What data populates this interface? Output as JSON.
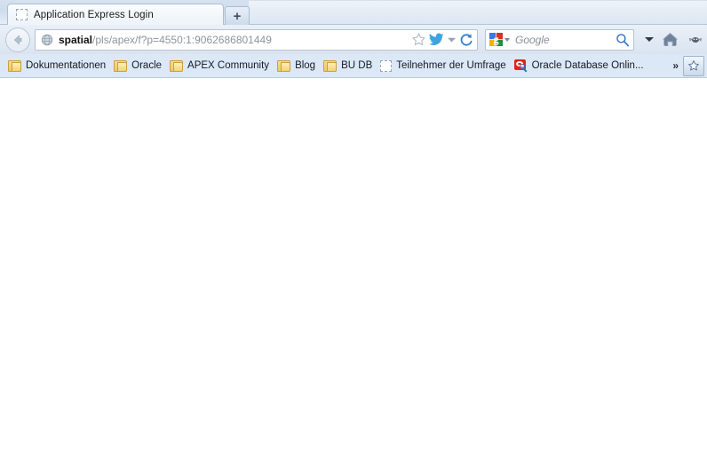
{
  "window": {
    "tab": {
      "title": "Application Express Login",
      "favicon": "placeholder-favicon"
    },
    "new_tab_label": "+"
  },
  "navigation": {
    "back_label": "←",
    "url": {
      "host": "spatial",
      "path": "/pls/apex/f?p=4550:1:9062686801449",
      "full": "spatial/pls/apex/f?p=4550:1:9062686801449"
    },
    "icons": {
      "site": "globe-icon",
      "bookmark": "star-icon",
      "twitter": "twitter-bird-icon",
      "dropdown": "chevron-down-icon",
      "reload": "reload-icon",
      "home": "home-icon",
      "edge": "grayscale-icon"
    },
    "search": {
      "engine": "Google",
      "placeholder": "Google",
      "submit": "search-icon"
    }
  },
  "bookmarks_bar": {
    "items": [
      {
        "label": "Dokumentationen",
        "icon": "folder-icon"
      },
      {
        "label": "Oracle",
        "icon": "folder-icon"
      },
      {
        "label": "APEX Community",
        "icon": "folder-icon"
      },
      {
        "label": "Blog",
        "icon": "folder-icon"
      },
      {
        "label": "BU DB",
        "icon": "folder-icon"
      },
      {
        "label": "Teilnehmer der Umfrage",
        "icon": "placeholder-favicon"
      },
      {
        "label": "Oracle Database Onlin...",
        "icon": "oracle-search-icon"
      }
    ],
    "overflow_label": "»",
    "star_button": "star-icon"
  },
  "page": {
    "body_text": ""
  },
  "colors": {
    "chrome_top": "#d6e1ef",
    "bookmarks_bg": "#dde8f6",
    "url_host_text": "#111111",
    "url_path_text": "#8e949c",
    "accent_blue": "#2f6fc4",
    "oracle_red": "#e8201a",
    "content_bg": "#ffffff"
  }
}
